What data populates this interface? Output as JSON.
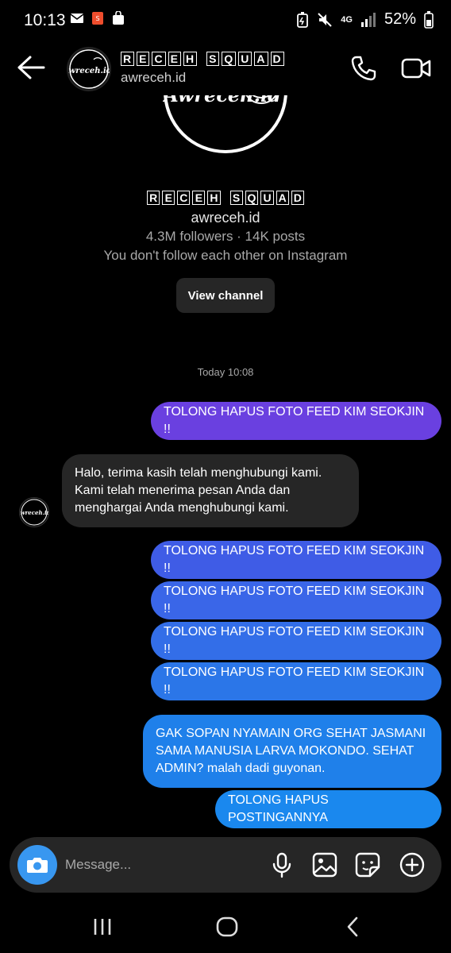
{
  "status_bar": {
    "time": "10:13",
    "network": "4G",
    "battery": "52%"
  },
  "header": {
    "name_letters": [
      "R",
      "E",
      "C",
      "E",
      "H",
      "S",
      "Q",
      "U",
      "A",
      "D"
    ],
    "name_split_index": 5,
    "handle": "awreceh.id"
  },
  "profile": {
    "logo_text": "Awreceh.id",
    "handle": "awreceh.id",
    "stats": "4.3M followers · 14K posts",
    "mutual": "You don't follow each other on Instagram",
    "view_channel_label": "View channel"
  },
  "thread": {
    "timestamp": "Today 10:08",
    "messages": [
      {
        "dir": "out",
        "text": "TOLONG HAPUS FOTO FEED KIM SEOKJIN !!",
        "color": "#6a40e0"
      },
      {
        "dir": "in",
        "text": "Halo, terima kasih telah menghubungi kami. Kami telah menerima pesan Anda dan menghargai Anda menghubungi kami."
      },
      {
        "dir": "out",
        "text": "TOLONG HAPUS FOTO FEED KIM SEOKJIN !!",
        "color": "#3f5ce6"
      },
      {
        "dir": "out",
        "text": "TOLONG HAPUS FOTO FEED KIM SEOKJIN !!",
        "color": "#3a66e8"
      },
      {
        "dir": "out",
        "text": "TOLONG HAPUS FOTO FEED KIM SEOKJIN !!",
        "color": "#336ee8"
      },
      {
        "dir": "out",
        "text": "TOLONG HAPUS FOTO FEED KIM SEOKJIN !!",
        "color": "#2b76e8"
      },
      {
        "dir": "out",
        "text": "GAK SOPAN NYAMAIN ORG SEHAT JASMANI SAMA MANUSIA LARVA MOKONDO. SEHAT ADMIN? malah dadi guyonan.",
        "color": "#1f80ea"
      },
      {
        "dir": "out",
        "text": "TOLONG HAPUS POSTINGANNYA",
        "color": "#1a88ee"
      }
    ]
  },
  "composer": {
    "placeholder": "Message..."
  },
  "colors": {
    "background": "#000000",
    "incoming_bubble": "#262626",
    "camera_button": "#3897f0"
  }
}
